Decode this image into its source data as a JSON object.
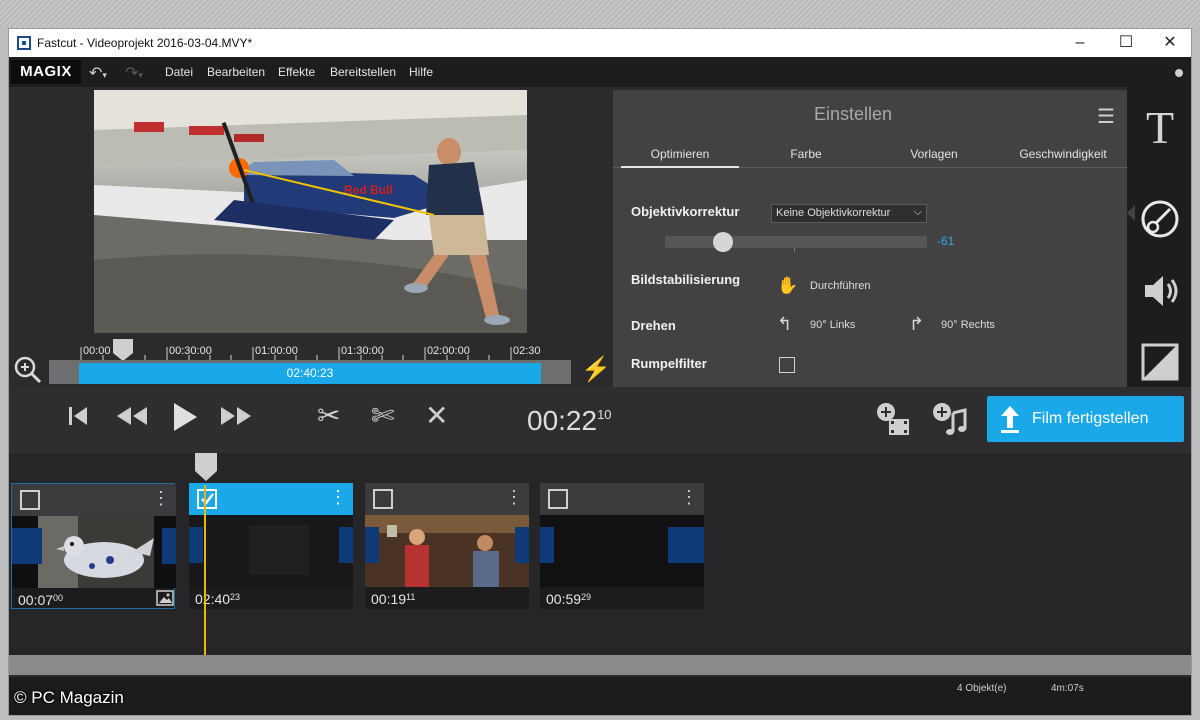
{
  "window": {
    "title": "Fastcut - Videoprojekt 2016-03-04.MVY*",
    "minimize": "–",
    "maximize": "☐",
    "close": "✕"
  },
  "menubar": {
    "logo": "MAGIX",
    "items": [
      "Datei",
      "Bearbeiten",
      "Effekte",
      "Bereitstellen",
      "Hilfe"
    ]
  },
  "preview_timeline": {
    "ticks": [
      "00:00",
      "00:30:00",
      "01:00:00",
      "01:30:00",
      "02:00:00",
      "02:30"
    ],
    "duration": "02:40:23"
  },
  "settings": {
    "title": "Einstellen",
    "tabs": [
      "Optimieren",
      "Farbe",
      "Vorlagen",
      "Geschwindigkeit"
    ],
    "active_tab": "Optimieren",
    "lens_label": "Objektivkorrektur",
    "lens_select": "Keine Objektivkorrektur",
    "lens_value": "-61",
    "lens_slider_fraction": 0.22,
    "stabilize_label": "Bildstabilisierung",
    "stabilize_action": "Durchführen",
    "rotate_label": "Drehen",
    "rotate_left": "90° Links",
    "rotate_right": "90° Rechts",
    "rumble_label": "Rumpelfilter",
    "rumble_checked": false
  },
  "transport": {
    "time_main": "00:22",
    "time_frames": "10",
    "finish_button": "Film fertigstellen"
  },
  "clips": [
    {
      "duration": "00:07",
      "frames": "00",
      "selected": false
    },
    {
      "duration": "02:40",
      "frames": "23",
      "selected": true
    },
    {
      "duration": "00:19",
      "frames": "11",
      "selected": false
    },
    {
      "duration": "00:59",
      "frames": "29",
      "selected": false
    }
  ],
  "status": {
    "objects": "4 Objekt(e)",
    "total_time": "4m:07s"
  },
  "watermark": "© PC Magazin",
  "colors": {
    "accent": "#1aa8e8",
    "playhead": "#f0b400"
  }
}
